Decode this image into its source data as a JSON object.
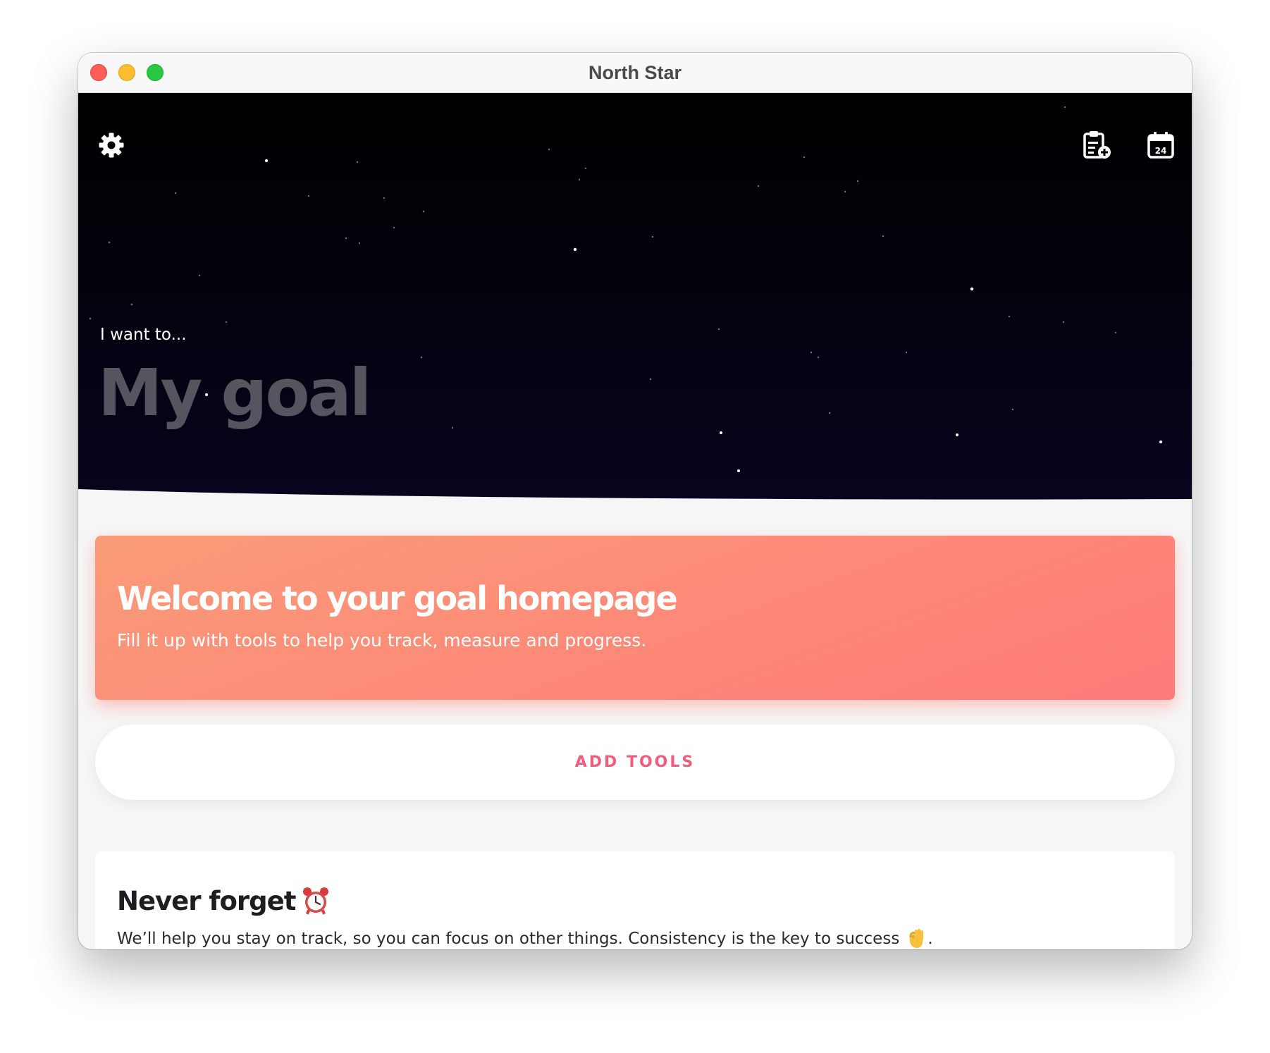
{
  "window": {
    "title": "North Star"
  },
  "hero": {
    "prompt": "I want to...",
    "goal_placeholder": "My goal",
    "goal_value": "",
    "icons": {
      "settings": "gear-icon",
      "add_task": "clipboard-add-icon",
      "calendar": "calendar-icon",
      "calendar_day": "24"
    }
  },
  "welcome": {
    "title": "Welcome to your goal homepage",
    "subtitle": "Fill it up with tools to help you track, measure and progress."
  },
  "add_tools": {
    "label": "ADD TOOLS"
  },
  "never_forget": {
    "title": "Never forget",
    "title_icon": "alarm-clock-icon",
    "body": "We’ll help you stay on track, so you can focus on other things. Consistency is the key to success",
    "body_icon": "ok-hand-icon",
    "body_end": "."
  },
  "colors": {
    "accent": "#ef5c7c",
    "welcome_gradient_start": "#f99b78",
    "welcome_gradient_end": "#fe7b7a",
    "hero_top": "#000000",
    "hero_bottom": "#07041f"
  }
}
